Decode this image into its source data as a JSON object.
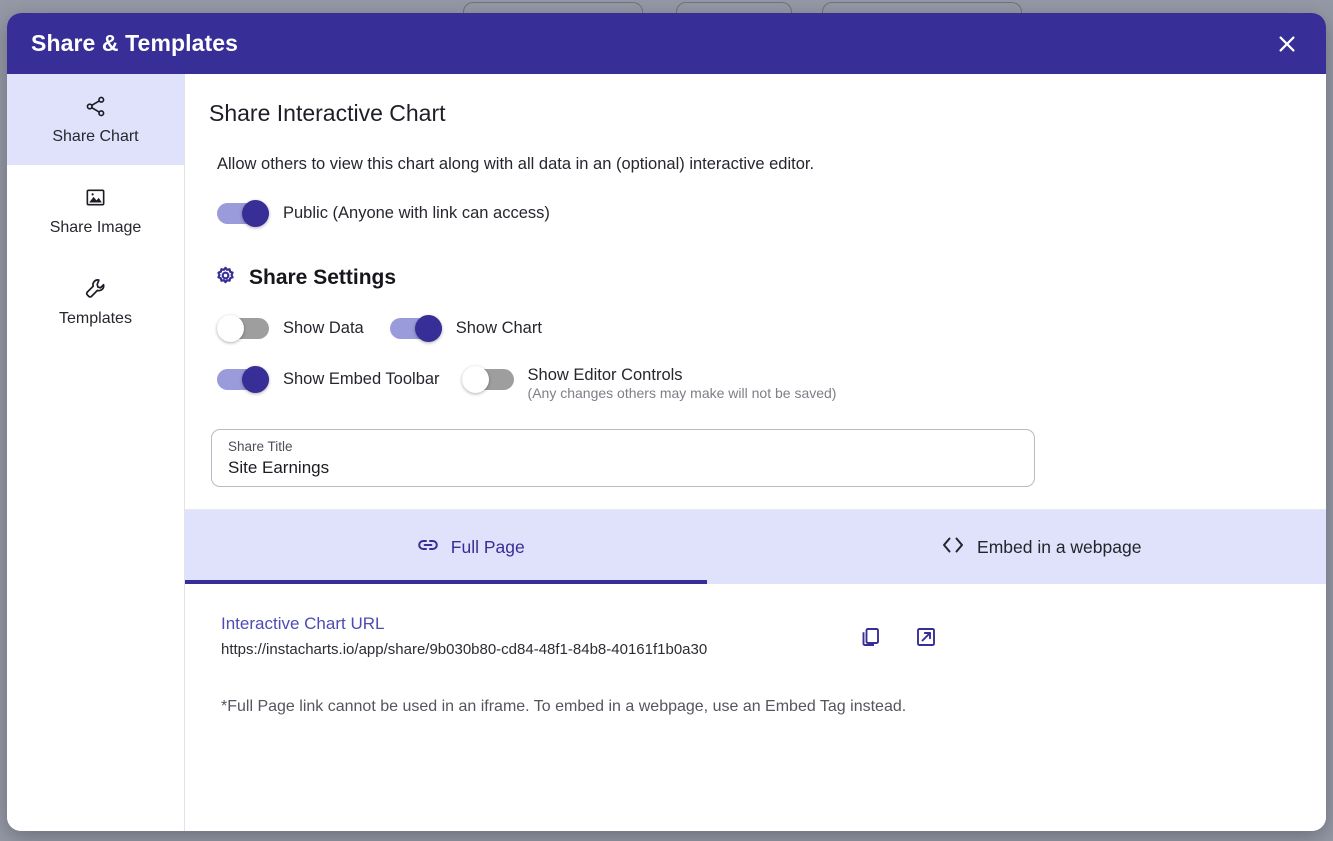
{
  "window": {
    "title": "Share & Templates",
    "close_icon": "close-icon",
    "header_bg": "#372f97"
  },
  "sidebar": {
    "items": [
      {
        "label": "Share Chart",
        "icon": "share-nodes-icon",
        "active": true
      },
      {
        "label": "Share Image",
        "icon": "image-icon",
        "active": false
      },
      {
        "label": "Templates",
        "icon": "wrench-icon",
        "active": false
      }
    ]
  },
  "main": {
    "section_title": "Share Interactive Chart",
    "description": "Allow others to view this chart along with all data in an (optional) interactive editor.",
    "public_toggle": {
      "label": "Public (Anyone with link can access)",
      "state": "on"
    },
    "settings": {
      "icon": "gear-icon",
      "heading": "Share Settings",
      "toggles": [
        {
          "label": "Show Data",
          "state": "off",
          "sub": ""
        },
        {
          "label": "Show Chart",
          "state": "on",
          "sub": ""
        },
        {
          "label": "Show Embed Toolbar",
          "state": "on",
          "sub": ""
        },
        {
          "label": "Show Editor Controls",
          "state": "off",
          "sub": "(Any changes others may make will not be saved)"
        }
      ]
    },
    "share_title_field": {
      "label": "Share Title",
      "value": "Site Earnings",
      "placeholder": "Share Title"
    },
    "tabs": [
      {
        "label": "Full Page",
        "icon": "link-icon",
        "active": true
      },
      {
        "label": "Embed in a webpage",
        "icon": "code-brackets-icon",
        "active": false
      }
    ],
    "url_block": {
      "label": "Interactive Chart URL",
      "url": "https://instacharts.io/app/share/9b030b80-cd84-48f1-84b8-40161f1b0a30",
      "copy_icon": "copy-icon",
      "open_icon": "external-link-icon",
      "note": "*Full Page link cannot be used in an iframe. To embed in a webpage, use an Embed Tag instead."
    }
  },
  "colors": {
    "accent": "#372f97",
    "accent_light": "#9a9bdb",
    "tab_bg": "#dfe2fa",
    "link": "#4e4bb5",
    "toggle_off": "#9e9e9e"
  }
}
